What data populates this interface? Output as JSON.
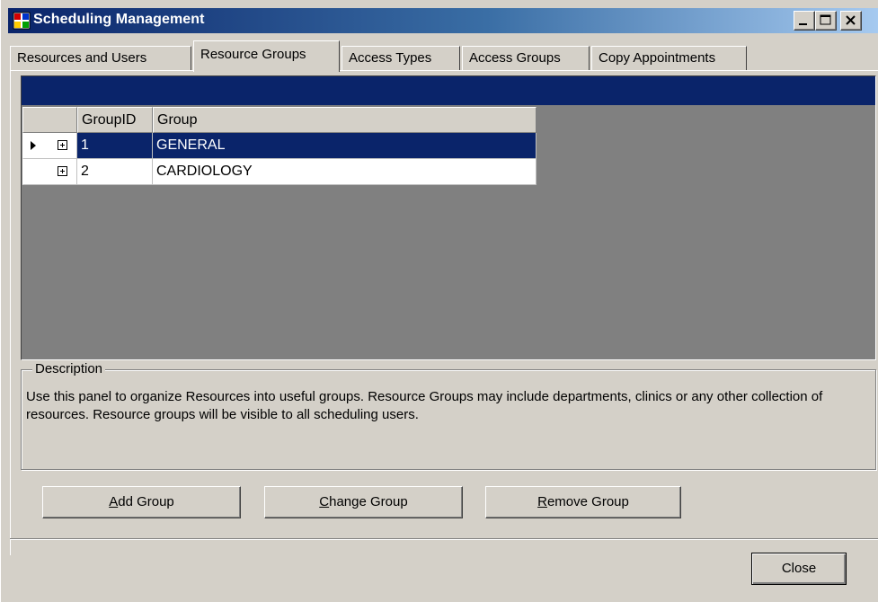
{
  "window": {
    "title": "Scheduling Management",
    "controls": {
      "minimize": "_",
      "maximize": "□",
      "close": "x"
    }
  },
  "tabs": [
    {
      "label": "Resources and Users",
      "active": false
    },
    {
      "label": "Resource Groups",
      "active": true
    },
    {
      "label": "Access Types",
      "active": false
    },
    {
      "label": "Access Groups",
      "active": false
    },
    {
      "label": "Copy Appointments",
      "active": false
    }
  ],
  "grid": {
    "columns": [
      "GroupID",
      "Group"
    ],
    "rows": [
      {
        "id": "1",
        "group": "GENERAL",
        "selected": true
      },
      {
        "id": "2",
        "group": "CARDIOLOGY",
        "selected": false
      }
    ]
  },
  "description": {
    "legend": "Description",
    "text": "Use this panel to organize Resources into useful groups.  Resource Groups may include departments, clinics or any other collection of resources.  Resource groups will be visible to all scheduling users."
  },
  "buttons": {
    "add_accel": "A",
    "add_rest": "dd Group",
    "change_accel": "C",
    "change_rest": "hange Group",
    "remove_accel": "R",
    "remove_rest": "emove Group",
    "close": "Close"
  },
  "colors": {
    "selection": "#0a246a",
    "window_bg": "#d4d0c8",
    "grid_bg": "#808080"
  }
}
